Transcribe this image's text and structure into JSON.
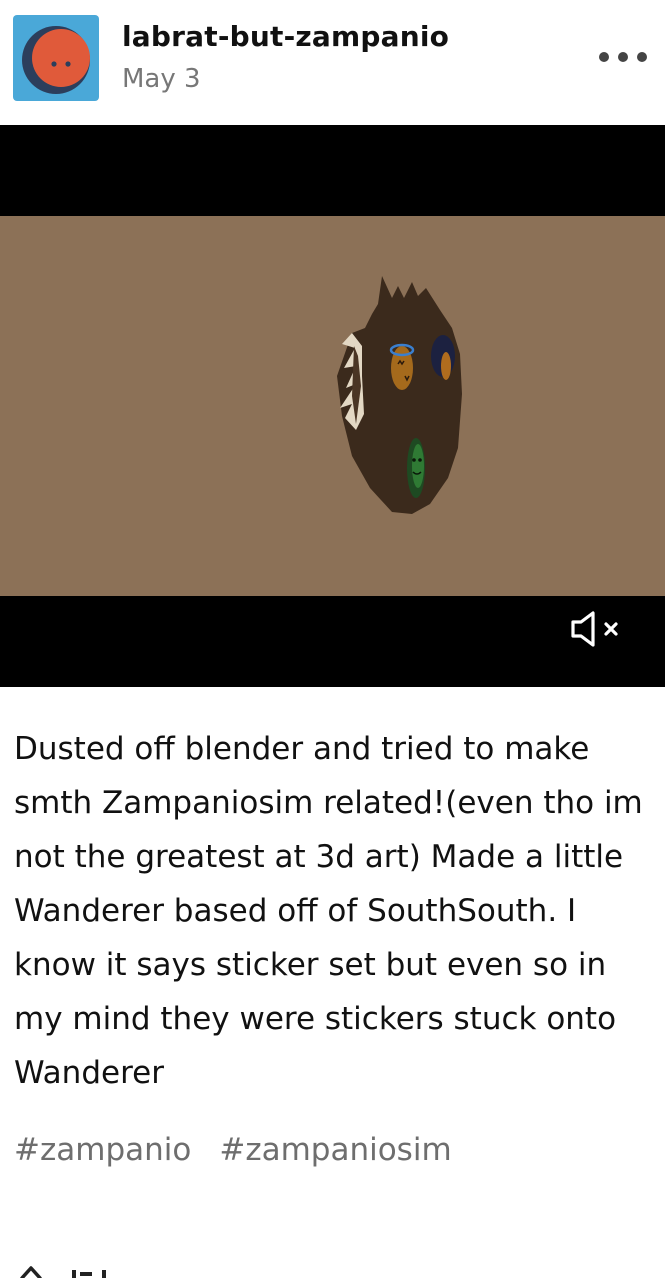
{
  "post": {
    "username": "labrat-but-zampanio",
    "date": "May 3",
    "avatar_icon": "red-face-moon-avatar",
    "more_icon": "ellipsis-icon",
    "video": {
      "mute_icon": "speaker-muted-icon"
    },
    "caption": "Dusted off blender and tried to make smth Zampaniosim related!(even tho im not the greatest at 3d art) Made a little Wanderer based off of SouthSouth. I know it says sticker set but even so in my mind they were stickers stuck onto Wanderer",
    "tags": [
      "#zampanio",
      "#zampaniosim"
    ]
  },
  "colors": {
    "avatar_bg": "#4aa8d8",
    "avatar_face": "#e05a3a",
    "video_bg": "#8c7157",
    "tag_text": "#6e6e6e",
    "date_text": "#777777"
  }
}
